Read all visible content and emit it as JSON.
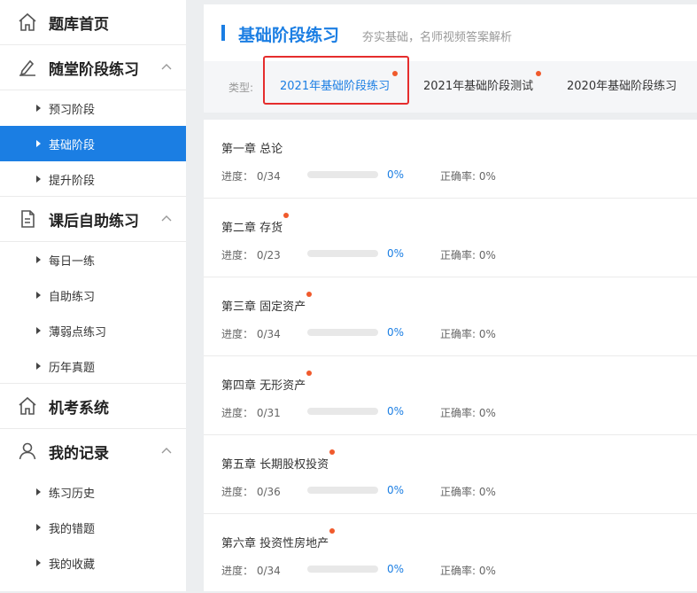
{
  "sidebar": {
    "home": {
      "label": "题库首页",
      "icon": "home-icon"
    },
    "classroom": {
      "label": "随堂阶段练习",
      "icon": "pencil-icon",
      "items": [
        {
          "label": "预习阶段",
          "active": false
        },
        {
          "label": "基础阶段",
          "active": true
        },
        {
          "label": "提升阶段",
          "active": false
        }
      ]
    },
    "selfstudy": {
      "label": "课后自助练习",
      "icon": "document-icon",
      "items": [
        {
          "label": "每日一练"
        },
        {
          "label": "自助练习"
        },
        {
          "label": "薄弱点练习"
        },
        {
          "label": "历年真题"
        }
      ]
    },
    "exam": {
      "label": "机考系统",
      "icon": "home-icon"
    },
    "records": {
      "label": "我的记录",
      "icon": "user-icon",
      "items": [
        {
          "label": "练习历史"
        },
        {
          "label": "我的错题"
        },
        {
          "label": "我的收藏"
        }
      ]
    }
  },
  "header": {
    "title": "基础阶段练习",
    "subtitle": "夯实基础，名师视频答案解析"
  },
  "typebar": {
    "label": "类型:",
    "tabs": [
      {
        "label": "2021年基础阶段练习",
        "active": true,
        "dot": true
      },
      {
        "label": "2021年基础阶段测试",
        "active": false,
        "dot": true
      },
      {
        "label": "2020年基础阶段练习",
        "active": false,
        "dot": false
      }
    ]
  },
  "chapters": [
    {
      "title": "第一章 总论",
      "dot": false,
      "progress": "进度： 0/34",
      "percent": "0%",
      "progress_fraction": 0,
      "accuracy": "正确率: 0%"
    },
    {
      "title": "第二章 存货",
      "dot": true,
      "progress": "进度： 0/23",
      "percent": "0%",
      "progress_fraction": 0,
      "accuracy": "正确率: 0%"
    },
    {
      "title": "第三章 固定资产",
      "dot": true,
      "progress": "进度： 0/34",
      "percent": "0%",
      "progress_fraction": 0,
      "accuracy": "正确率: 0%"
    },
    {
      "title": "第四章 无形资产",
      "dot": true,
      "progress": "进度： 0/31",
      "percent": "0%",
      "progress_fraction": 0,
      "accuracy": "正确率: 0%"
    },
    {
      "title": "第五章 长期股权投资",
      "dot": true,
      "progress": "进度： 0/36",
      "percent": "0%",
      "progress_fraction": 0,
      "accuracy": "正确率: 0%"
    },
    {
      "title": "第六章 投资性房地产",
      "dot": true,
      "progress": "进度： 0/34",
      "percent": "0%",
      "progress_fraction": 0,
      "accuracy": "正确率: 0%"
    }
  ],
  "colors": {
    "accent": "#1b7ee3",
    "dot": "#f05a2c",
    "highlight": "#e52d2d"
  }
}
